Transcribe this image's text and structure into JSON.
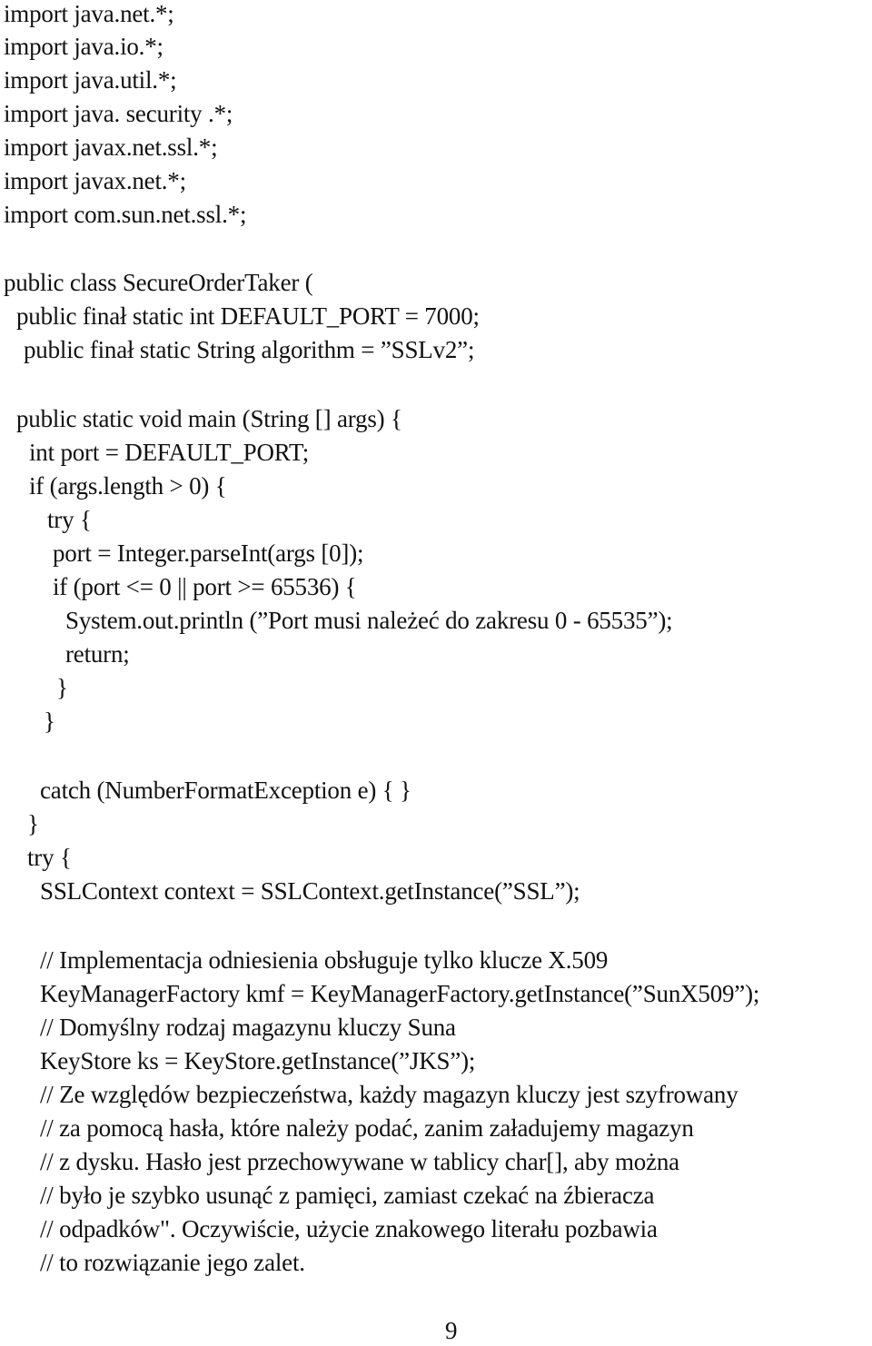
{
  "document": {
    "page_number": "9",
    "lines": [
      "import java.net.*;",
      "import java.io.*;",
      "import java.util.*;",
      "import java. security .*;",
      "import javax.net.ssl.*;",
      "import javax.net.*;",
      "import com.sun.net.ssl.*;",
      "public class SecureOrderTaker (",
      "public finał static int DEFAULT_PORT = 7000;",
      "public finał static String algorithm = ”SSLv2”;",
      "public static void main (String [] args) {",
      "int port = DEFAULT_PORT;",
      "if (args.length > 0) {",
      "try {",
      "port = Integer.parseInt(args [0]);",
      "if (port <= 0 || port >= 65536) {",
      "System.out.println (”Port musi należeć do zakresu 0 - 65535”);",
      "return;",
      "}",
      "}",
      "catch (NumberFormatException e) { }",
      "}",
      "try {",
      "SSLContext context = SSLContext.getInstance(”SSL”);",
      "// Implementacja odniesienia obsługuje tylko klucze X.509",
      "KeyManagerFactory kmf = KeyManagerFactory.getInstance(”SunX509”);",
      "// Domyślny rodzaj magazynu kluczy Suna",
      "KeyStore ks = KeyStore.getInstance(”JKS”);",
      "// Ze względów bezpieczeństwa, każdy magazyn kluczy jest szyfrowany",
      "// za pomocą hasła, które należy podać, zanim załadujemy magazyn",
      "// z dysku. Hasło jest przechowywane w tablicy char[], aby można",
      "// było je szybko usunąć z pamięci, zamiast czekać na źbieracza",
      "// odpadków\". Oczywiście, użycie znakowego literału pozbawia",
      "// to rozwiązanie jego zalet."
    ]
  }
}
